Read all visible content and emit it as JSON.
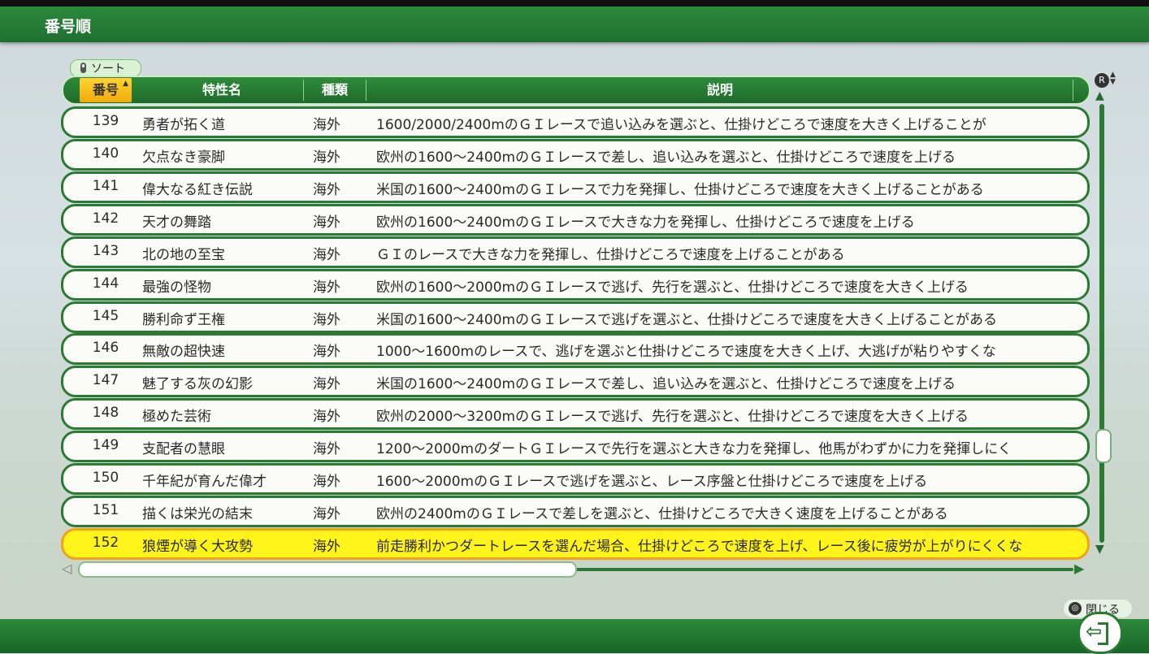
{
  "title": "番号順",
  "sort_label": "ソート",
  "columns": {
    "number": "番号",
    "name": "特性名",
    "type": "種類",
    "desc": "説明"
  },
  "rows": [
    {
      "num": "139",
      "name": "勇者が拓く道",
      "type": "海外",
      "desc": "1600/2000/2400mのＧＩレースで追い込みを選ぶと、仕掛けどころで速度を大きく上げることが"
    },
    {
      "num": "140",
      "name": "欠点なき豪脚",
      "type": "海外",
      "desc": "欧州の1600～2400mのＧＩレースで差し、追い込みを選ぶと、仕掛けどころで速度を上げる"
    },
    {
      "num": "141",
      "name": "偉大なる紅き伝説",
      "type": "海外",
      "desc": "米国の1600～2400mのＧＩレースで力を発揮し、仕掛けどころで速度を大きく上げることがある"
    },
    {
      "num": "142",
      "name": "天才の舞踏",
      "type": "海外",
      "desc": "欧州の1600～2400mのＧＩレースで大きな力を発揮し、仕掛けどころで速度を上げる"
    },
    {
      "num": "143",
      "name": "北の地の至宝",
      "type": "海外",
      "desc": "ＧＩのレースで大きな力を発揮し、仕掛けどころで速度を上げることがある"
    },
    {
      "num": "144",
      "name": "最強の怪物",
      "type": "海外",
      "desc": "欧州の1600～2000mのＧＩレースで逃げ、先行を選ぶと、仕掛けどころで速度を大きく上げる"
    },
    {
      "num": "145",
      "name": "勝利命ず王権",
      "type": "海外",
      "desc": "米国の1600～2400mのＧＩレースで逃げを選ぶと、仕掛けどころで速度を大きく上げることがある"
    },
    {
      "num": "146",
      "name": "無敵の超快速",
      "type": "海外",
      "desc": "1000～1600mのレースで、逃げを選ぶと仕掛けどころで速度を大きく上げ、大逃げが粘りやすくな"
    },
    {
      "num": "147",
      "name": "魅了する灰の幻影",
      "type": "海外",
      "desc": "米国の1600～2400mのＧＩレースで差し、追い込みを選ぶと、仕掛けどころで速度を上げる"
    },
    {
      "num": "148",
      "name": "極めた芸術",
      "type": "海外",
      "desc": "欧州の2000～3200mのＧＩレースで逃げ、先行を選ぶと、仕掛けどころで速度を大きく上げる"
    },
    {
      "num": "149",
      "name": "支配者の慧眼",
      "type": "海外",
      "desc": "1200～2000mのダートＧＩレースで先行を選ぶと大きな力を発揮し、他馬がわずかに力を発揮しにく"
    },
    {
      "num": "150",
      "name": "千年紀が育んだ偉才",
      "type": "海外",
      "desc": "1600～2000mのＧＩレースで逃げを選ぶと、レース序盤と仕掛けどころで速度を上げる"
    },
    {
      "num": "151",
      "name": "描くは栄光の結末",
      "type": "海外",
      "desc": "欧州の2400mのＧＩレースで差しを選ぶと、仕掛けどころで大きく速度を上げることがある"
    },
    {
      "num": "152",
      "name": "狼煙が導く大攻勢",
      "type": "海外",
      "desc": "前走勝利かつダートレースを選んだ場合、仕掛けどころで速度を上げ、レース後に疲労が上がりにくくな"
    }
  ],
  "selected_row": "152",
  "close_label": "閉じる",
  "button_glyphs": {
    "r_button": "R",
    "o_button": "◎"
  },
  "icons": [
    "sort-stick-icon",
    "sort-ascending-icon",
    "scroll-up-icon",
    "scroll-down-icon",
    "scroll-left-icon",
    "scroll-right-icon",
    "r-button-icon",
    "o-button-icon",
    "exit-icon"
  ],
  "colors": {
    "accent_green": "#2a7a33",
    "header_gold": "#f1a90b",
    "selected_yellow": "#fff41a"
  }
}
